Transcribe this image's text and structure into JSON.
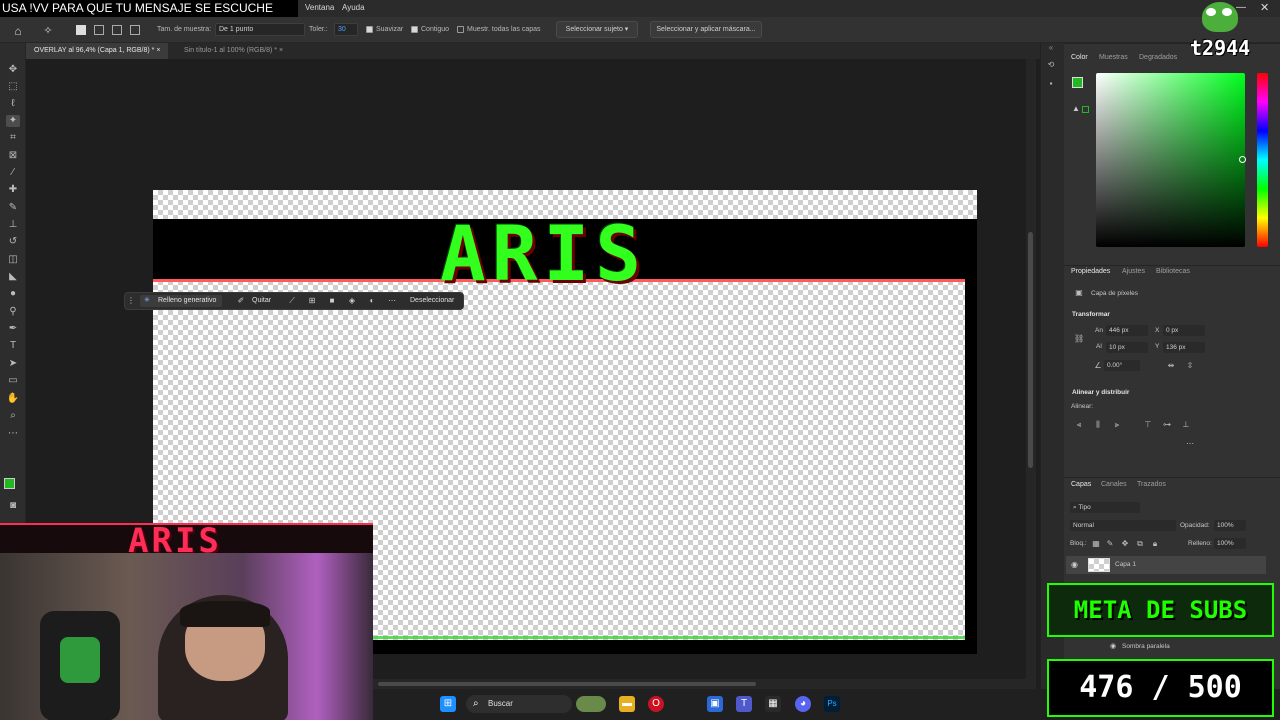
{
  "ticker": "USA !VV PARA QUE TU MENSAJE SE ESCUCHE",
  "menu": [
    "Ventana",
    "Ayuda"
  ],
  "options": {
    "sample_size_label": "Tam. de muestra:",
    "sample_size_value": "De 1 punto",
    "tolerance_label": "Toler.:",
    "tolerance_value": "30",
    "antialias": "Suavizar",
    "contiguous": "Contiguo",
    "sample_all": "Muestr. todas las capas",
    "select_subject": "Seleccionar sujeto",
    "select_mask": "Seleccionar y aplicar máscara..."
  },
  "tabs": [
    {
      "label": "OVERLAY al 96,4% (Capa 1, RGB/8) *",
      "close": "×"
    },
    {
      "label": "Sin título-1 al 100% (RGB/8) *",
      "close": "×"
    }
  ],
  "canvas": {
    "title": "ARIS"
  },
  "context_bar": {
    "generative_fill": "Relleno generativo",
    "remove": "Quitar",
    "deselect": "Deseleccionar"
  },
  "color_panel": {
    "tabs": [
      "Color",
      "Muestras",
      "Degradados"
    ],
    "foreground": "#21b821",
    "background": "#ffffff"
  },
  "properties_panel": {
    "tabs": [
      "Propiedades",
      "Ajustes",
      "Bibliotecas"
    ],
    "layer_type": "Capa de píxeles",
    "transform_title": "Transformar",
    "width_label": "An",
    "width_value": "446 px",
    "height_label": "Al",
    "height_value": "10 px",
    "x_label": "X",
    "x_value": "0 px",
    "y_label": "Y",
    "y_value": "136 px",
    "angle_value": "0.00°",
    "align_title": "Alinear y distribuir",
    "align_label": "Alinear:"
  },
  "layers_panel": {
    "tabs": [
      "Capas",
      "Canales",
      "Trazados"
    ],
    "filter": "Tipo",
    "blend_mode": "Normal",
    "opacity_label": "Opacidad:",
    "opacity_value": "100%",
    "lock_label": "Bloq.:",
    "fill_label": "Relleno:",
    "fill_value": "100%",
    "layer_name": "Capa 1",
    "effect_name": "Sombra paralela"
  },
  "overlay": {
    "webcam_title": "ARIS",
    "meta": "META DE SUBS",
    "count": "476 / 500",
    "avatar_text": "t2944",
    "sub_current": 476,
    "sub_goal": 500
  },
  "taskbar": {
    "search": "Buscar"
  }
}
